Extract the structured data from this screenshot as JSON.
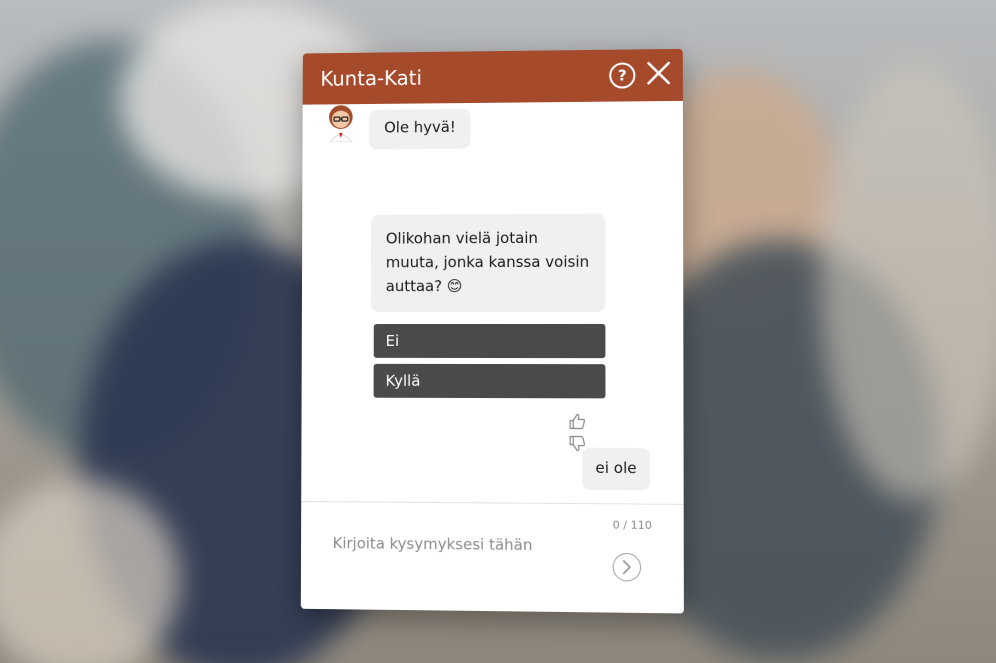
{
  "chat": {
    "title": "Kunta-Kati",
    "help_glyph": "?",
    "messages": [
      {
        "from": "bot",
        "text": "Ole hyvä!"
      },
      {
        "from": "bot",
        "text": "Olikohan vielä jotain muuta, jonka kanssa voisin auttaa? 😊"
      }
    ],
    "options": [
      "Ei",
      "Kyllä"
    ],
    "user_reply": "ei ole",
    "input": {
      "placeholder": "Kirjoita kysymyksesi tähän",
      "value": "",
      "char_count": "0 / 110"
    }
  },
  "icons": {
    "help": "help-icon",
    "close": "close-icon",
    "thumbs_up": "thumbs-up-icon",
    "thumbs_down": "thumbs-down-icon",
    "send": "chevron-right-icon",
    "avatar": "bot-avatar"
  },
  "colors": {
    "header": "#a64a2c",
    "option_button": "#4a4a4a",
    "bubble": "#f1f0f1"
  }
}
